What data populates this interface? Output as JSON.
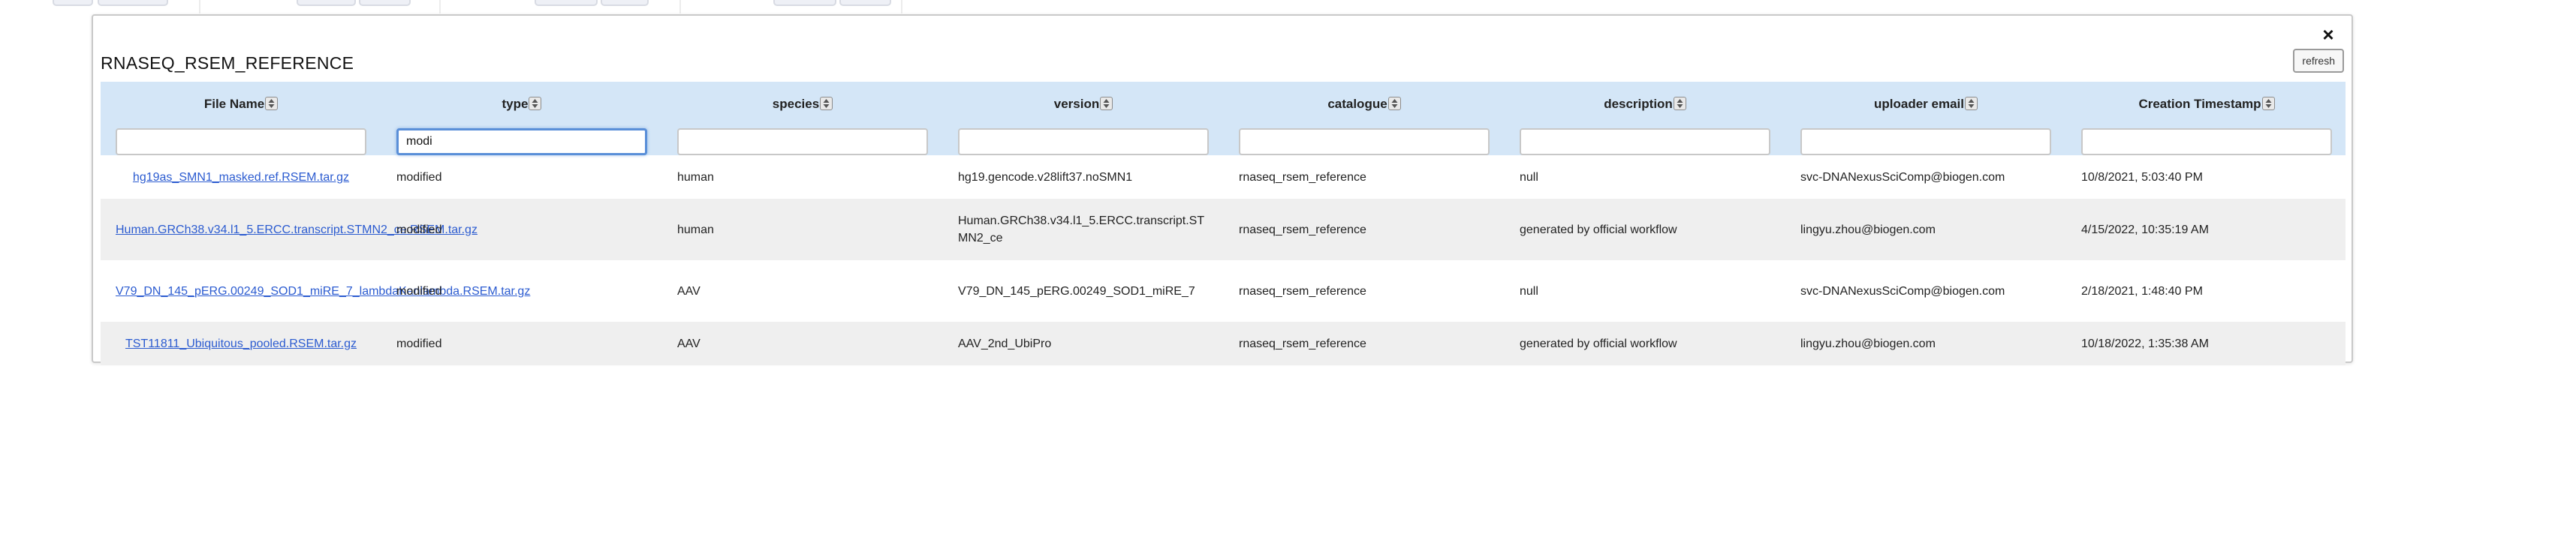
{
  "modal": {
    "title": "RNASEQ_RSEM_REFERENCE",
    "close_label": "×",
    "refresh_label": "refresh"
  },
  "columns": [
    {
      "label": "File Name",
      "filter": ""
    },
    {
      "label": "type",
      "filter": "modi"
    },
    {
      "label": "species",
      "filter": ""
    },
    {
      "label": "version",
      "filter": ""
    },
    {
      "label": "catalogue",
      "filter": ""
    },
    {
      "label": "description",
      "filter": ""
    },
    {
      "label": "uploader email",
      "filter": ""
    },
    {
      "label": "Creation Timestamp",
      "filter": ""
    }
  ],
  "rows": [
    {
      "file": "hg19as_SMN1_masked.ref.RSEM.tar.gz",
      "type": "modified",
      "species": "human",
      "version": "hg19.gencode.v28lift37.noSMN1",
      "catalogue": "rnaseq_rsem_reference",
      "description": "null",
      "email": "svc-DNANexusSciComp@biogen.com",
      "timestamp": "10/8/2021, 5:03:40 PM"
    },
    {
      "file": "Human.GRCh38.v34.l1_5.ERCC.transcript.STMN2_ce.RSEM.tar.gz",
      "type": "modified",
      "species": "human",
      "version": "Human.GRCh38.v34.l1_5.ERCC.transcript.STMN2_ce",
      "catalogue": "rnaseq_rsem_reference",
      "description": "generated by official workflow",
      "email": "lingyu.zhou@biogen.com",
      "timestamp": "4/15/2022, 10:35:19 AM"
    },
    {
      "file": "V79_DN_145_pERG.00249_SOD1_miRE_7_lambdaKanlambda.RSEM.tar.gz",
      "type": "modified",
      "species": "AAV",
      "version": "V79_DN_145_pERG.00249_SOD1_miRE_7",
      "catalogue": "rnaseq_rsem_reference",
      "description": "null",
      "email": "svc-DNANexusSciComp@biogen.com",
      "timestamp": "2/18/2021, 1:48:40 PM"
    },
    {
      "file": "TST11811_Ubiquitous_pooled.RSEM.tar.gz",
      "type": "modified",
      "species": "AAV",
      "version": "AAV_2nd_UbiPro",
      "catalogue": "rnaseq_rsem_reference",
      "description": "generated by official workflow",
      "email": "lingyu.zhou@biogen.com",
      "timestamp": "10/18/2022, 1:35:38 AM"
    }
  ],
  "colors": {
    "header_bg": "#d4e6f7",
    "link": "#2b5bd0",
    "row_alt": "#efefef",
    "focus": "#5a8fd8"
  },
  "icons": {
    "sort": "sort-arrows-icon",
    "close": "close-icon"
  }
}
